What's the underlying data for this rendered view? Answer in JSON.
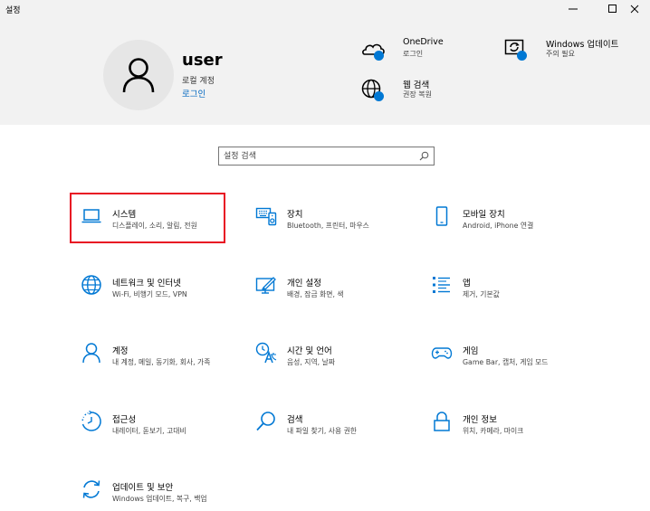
{
  "window": {
    "title": "설정",
    "controls": [
      "minimize",
      "maximize",
      "close"
    ]
  },
  "account": {
    "username": "user",
    "type": "로컬 계정",
    "signin_link": "로그인"
  },
  "header_items": [
    {
      "title": "OneDrive",
      "subtitle": "로그인",
      "icon": "cloud-icon"
    },
    {
      "title": "Windows 업데이트",
      "subtitle": "주의 필요",
      "icon": "update-sync-icon"
    },
    {
      "title": "웹 검색",
      "subtitle": "권장 복원",
      "icon": "globe-icon"
    }
  ],
  "search": {
    "placeholder": "설정 검색",
    "value": ""
  },
  "colors": {
    "accent": "#0078d4",
    "selection_border": "#e81123",
    "header_bg": "#f2f2f2"
  },
  "categories": [
    {
      "title": "시스템",
      "description": "디스플레이, 소리, 알림, 전원",
      "icon": "laptop-icon",
      "selected": true
    },
    {
      "title": "장치",
      "description": "Bluetooth, 프린터, 마우스",
      "icon": "devices-icon"
    },
    {
      "title": "모바일 장치",
      "description": "Android, iPhone 연결",
      "icon": "phone-icon"
    },
    {
      "title": "네트워크 및 인터넷",
      "description": "Wi-Fi, 비행기 모드, VPN",
      "icon": "network-globe-icon"
    },
    {
      "title": "개인 설정",
      "description": "배경, 잠금 화면, 색",
      "icon": "personalization-icon"
    },
    {
      "title": "앱",
      "description": "제거, 기본값",
      "icon": "apps-list-icon"
    },
    {
      "title": "계정",
      "description": "내 계정, 메일, 동기화, 회사, 가족",
      "icon": "person-icon"
    },
    {
      "title": "시간 및 언어",
      "description": "음성, 지역, 날짜",
      "icon": "time-language-icon"
    },
    {
      "title": "게임",
      "description": "Game Bar, 캡처, 게임 모드",
      "icon": "gamepad-icon"
    },
    {
      "title": "접근성",
      "description": "내레이터, 돋보기, 고대비",
      "icon": "accessibility-timer-icon"
    },
    {
      "title": "검색",
      "description": "내 파일 찾기, 사용 권한",
      "icon": "magnifier-icon"
    },
    {
      "title": "개인 정보",
      "description": "위치, 카메라, 마이크",
      "icon": "lock-icon"
    },
    {
      "title": "업데이트 및 보안",
      "description": "Windows 업데이트, 복구, 백업",
      "icon": "sync-arrows-icon"
    }
  ]
}
